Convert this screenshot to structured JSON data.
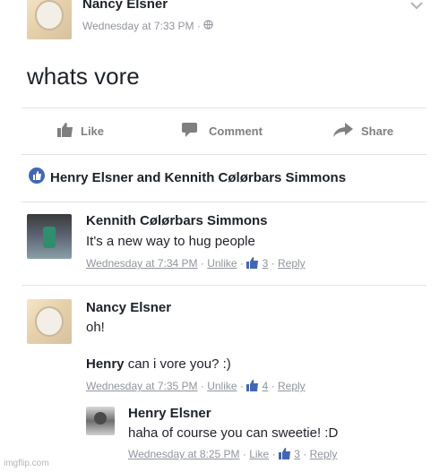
{
  "post": {
    "author": "Nancy Elsner",
    "timestamp": "Wednesday at 7:33 PM",
    "text": "whats vore"
  },
  "actions": {
    "like": "Like",
    "comment": "Comment",
    "share": "Share"
  },
  "reactions": {
    "text": "Henry Elsner and Kennith Cølørbars Simmons"
  },
  "comments": [
    {
      "author": "Kennith Cølørbars Simmons",
      "text": "It's a new way to hug people",
      "time": "Wednesday at 7:34 PM",
      "unlike": "Unlike",
      "likes": "3",
      "reply": "Reply"
    },
    {
      "author": "Nancy Elsner",
      "text": "oh!",
      "mention": "Henry",
      "text2": "can i vore you? :)",
      "time": "Wednesday at 7:35 PM",
      "unlike": "Unlike",
      "likes": "4",
      "reply": "Reply"
    }
  ],
  "reply": {
    "author": "Henry Elsner",
    "text": "haha of course you can sweetie! :D",
    "time": "Wednesday at 8:25 PM",
    "like": "Like",
    "likes": "3",
    "reply": "Reply"
  },
  "watermark": "imgflip.com",
  "colors": {
    "link_blue": "#4267b2",
    "meta_gray": "#90949c",
    "text": "#1d2129"
  }
}
